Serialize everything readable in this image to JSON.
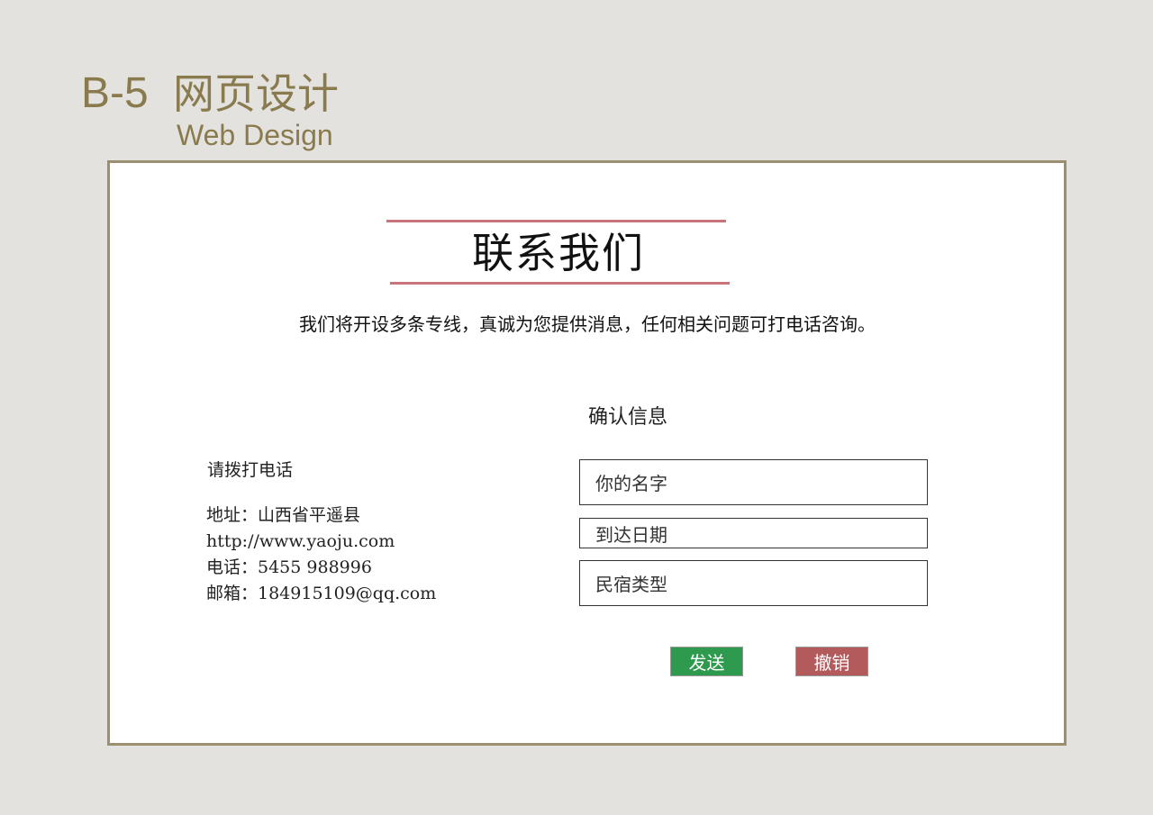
{
  "header": {
    "code": "B-5",
    "title_cn": "网页设计",
    "title_en": "Web Design"
  },
  "page": {
    "title": "联系我们",
    "intro": "我们将开设多条专线，真诚为您提供消息，任何相关问题可打电话咨询。"
  },
  "contact": {
    "call_label": "请拨打电话",
    "address": "地址：山西省平遥县",
    "website": "http://www.yaoju.com",
    "phone": "电话：5455  988996",
    "email": "邮箱：184915109@qq.com"
  },
  "form": {
    "heading": "确认信息",
    "name_placeholder": "你的名字",
    "date_placeholder": "到达日期",
    "type_placeholder": "民宿类型",
    "send_label": "发送",
    "cancel_label": "撤销"
  },
  "colors": {
    "accent_gold": "#8a7b4e",
    "title_rule": "#c9737a",
    "send_button": "#2e9a4d",
    "cancel_button": "#b35a5c"
  }
}
